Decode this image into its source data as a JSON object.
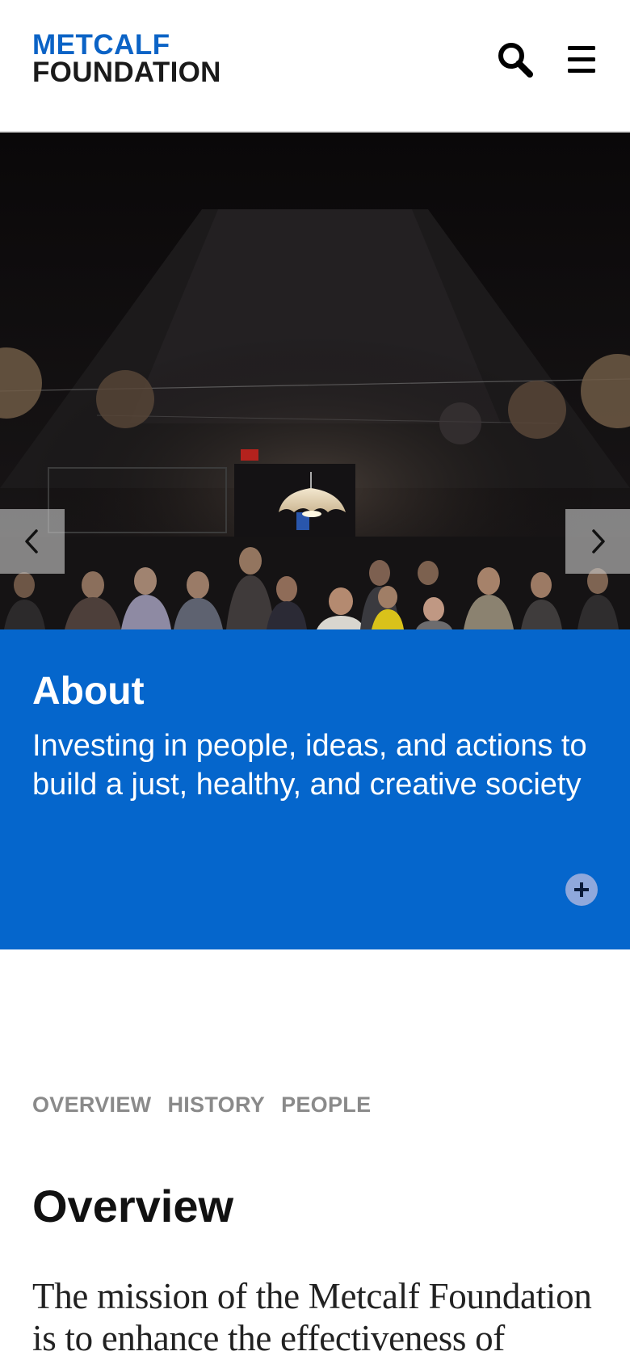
{
  "header": {
    "logo_line1": "METCALF",
    "logo_line2": "FOUNDATION",
    "search_icon": "search-icon",
    "menu_icon": "hamburger-menu-icon"
  },
  "hero": {
    "alt": "Audience seated in a darkened hall lit by a hanging lamp",
    "prev_icon": "chevron-left-icon",
    "next_icon": "chevron-right-icon",
    "exit_sign": "EXIT"
  },
  "about": {
    "title": "About",
    "tagline": "Investing in people, ideas, and actions to build a just, healthy, and creative society",
    "expand_icon": "plus-icon"
  },
  "subnav": {
    "items": [
      {
        "label": "OVERVIEW"
      },
      {
        "label": "HISTORY"
      },
      {
        "label": "PEOPLE"
      }
    ]
  },
  "overview": {
    "title": "Overview",
    "body": "The mission of the Metcalf Foundation is to enhance the effectiveness of"
  },
  "colors": {
    "brand_blue": "#0566cc",
    "logo_blue": "#0b63c6",
    "text_dark": "#111111",
    "subnav_gray": "#8a8a8a"
  }
}
